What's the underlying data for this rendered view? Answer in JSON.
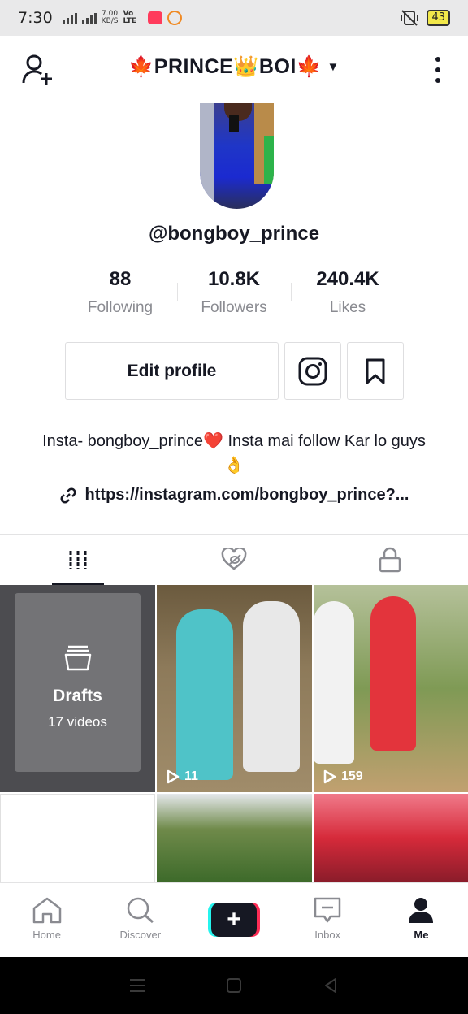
{
  "status_bar": {
    "time": "7:30",
    "net_speed": "7.00",
    "net_unit": "KB/S",
    "volte": "Vo LTE",
    "battery": "43"
  },
  "header": {
    "title_prefix": "PRINCE",
    "title_suffix": "BOI",
    "leaf_emoji": "🍁",
    "crown_emoji": "👑",
    "caret": "▼"
  },
  "profile": {
    "username": "@bongboy_prince",
    "stats": [
      {
        "value": "88",
        "label": "Following"
      },
      {
        "value": "10.8K",
        "label": "Followers"
      },
      {
        "value": "240.4K",
        "label": "Likes"
      }
    ],
    "edit_label": "Edit profile",
    "bio": "Insta- bongboy_prince❤️ Insta mai follow Kar lo guys👌",
    "link": "https://instagram.com/bongboy_prince?..."
  },
  "grid": {
    "drafts_title": "Drafts",
    "drafts_count": "17 videos",
    "video_views": [
      "11",
      "159"
    ]
  },
  "bottom_nav": {
    "home": "Home",
    "discover": "Discover",
    "create": "+",
    "inbox": "Inbox",
    "me": "Me"
  },
  "colors": {
    "text": "#161823",
    "secondary": "#8a8b91",
    "accent_cyan": "#25f4ee",
    "accent_red": "#fe2c55"
  }
}
